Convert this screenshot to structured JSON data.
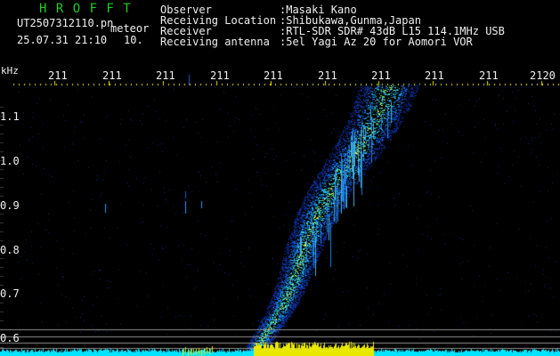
{
  "header": {
    "brand": "H R O F F T",
    "filename": "UT2507312110.pn",
    "kind": "meteor",
    "datetime": "25.07.31 21:10",
    "frame": "10."
  },
  "info": [
    {
      "label": "Observer",
      "value": ":Masaki Kano"
    },
    {
      "label": "Receiving Location",
      "value": ":Shibukawa,Gunma,Japan"
    },
    {
      "label": "Receiver",
      "value": ":RTL-SDR SDR# 43dB L15 114.1MHz USB"
    },
    {
      "label": "Receiving antenna",
      "value": ":5el Yagi Az 20 for Aomori VOR"
    }
  ],
  "axes": {
    "y_unit": "kHz",
    "x_ticks": [
      "211",
      "211",
      "211",
      "211",
      "211",
      "211",
      "211",
      "211",
      "211",
      "2120"
    ],
    "y_ticks": [
      "1.1",
      "1.0",
      "0.9",
      "0.8",
      "0.7",
      "0.6"
    ]
  },
  "colors": {
    "background": "#000000",
    "text": "#f0f0f0",
    "brand": "#22cc22",
    "tick_marks": "#e8e800",
    "baseline": "#e8e800",
    "noise": "#00e5ff"
  }
}
